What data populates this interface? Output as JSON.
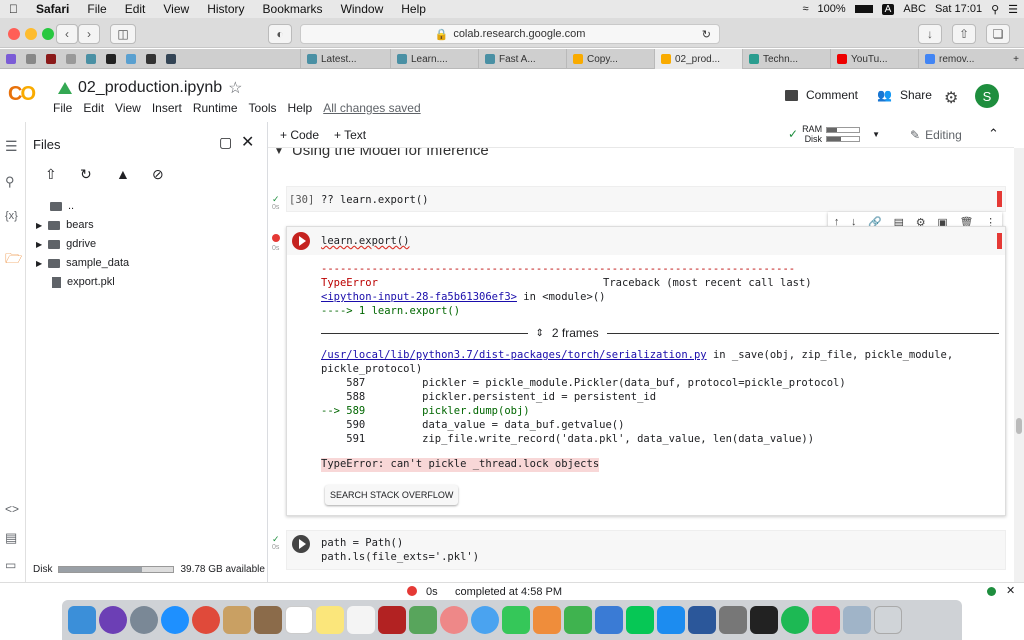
{
  "menubar": {
    "app": "Safari",
    "items": [
      "File",
      "Edit",
      "View",
      "History",
      "Bookmarks",
      "Window",
      "Help"
    ],
    "status": {
      "battery": "100%",
      "input": "ABC",
      "clock": "Sat 17:01"
    }
  },
  "browser": {
    "url": "colab.research.google.com",
    "tabs": [
      "Latest...",
      "Learn....",
      "Fast A...",
      "Copy...",
      "02_prod...",
      "Techn...",
      "YouTu...",
      "remov..."
    ],
    "active_tab": "02_prod..."
  },
  "colab": {
    "logo": "CO",
    "notebook_title": "02_production.ipynb",
    "menu": [
      "File",
      "Edit",
      "View",
      "Insert",
      "Runtime",
      "Tools",
      "Help"
    ],
    "save_status": "All changes saved",
    "comment_label": "Comment",
    "share_label": "Share",
    "avatar_letter": "S",
    "add_code": "+ Code",
    "add_text": "+ Text",
    "ram_label": "RAM",
    "disk_label": "Disk",
    "editing_label": "Editing"
  },
  "files_panel": {
    "title": "Files",
    "items": [
      {
        "name": "..",
        "type": "up"
      },
      {
        "name": "bears",
        "type": "folder"
      },
      {
        "name": "gdrive",
        "type": "folder"
      },
      {
        "name": "sample_data",
        "type": "folder"
      },
      {
        "name": "export.pkl",
        "type": "file"
      }
    ],
    "disk_label": "Disk",
    "disk_available": "39.78 GB available",
    "disk_used_fraction": 0.72
  },
  "notebook": {
    "section_heading": "Using the Model for Inference",
    "cell1": {
      "exec_count": "[30]",
      "code": "?? learn.export()",
      "time": "0s"
    },
    "cell2": {
      "code": "learn.export()",
      "time": "0s",
      "dash_line": "---------------------------------------------------------------------------",
      "error_type": "TypeError",
      "traceback_header": "Traceback (most recent call last)",
      "input_link": "<ipython-input-28-fa5b61306ef3>",
      "in_module": " in <module>()",
      "arrow_line": "----> 1 learn.export()",
      "frames_label": "2 frames",
      "file_link": "/usr/local/lib/python3.7/dist-packages/torch/serialization.py",
      "file_suffix": " in _save(obj, zip_file, pickle_module,",
      "file_suffix2": "pickle_protocol)",
      "lines": [
        "    587         pickler = pickle_module.Pickler(data_buf, protocol=pickle_protocol)",
        "    588         pickler.persistent_id = persistent_id",
        "--> 589         pickler.dump(obj)",
        "    590         data_value = data_buf.getvalue()",
        "    591         zip_file.write_record('data.pkl', data_value, len(data_value))"
      ],
      "error_message": "TypeError: can't pickle _thread.lock objects",
      "stack_button": "SEARCH STACK OVERFLOW"
    },
    "cell3": {
      "code_line1": "path = Path()",
      "code_line2": "path.ls(file_exts='.pkl')",
      "time": "0s"
    }
  },
  "status_bar": {
    "time": "0s",
    "message": "completed at 4:58 PM"
  }
}
